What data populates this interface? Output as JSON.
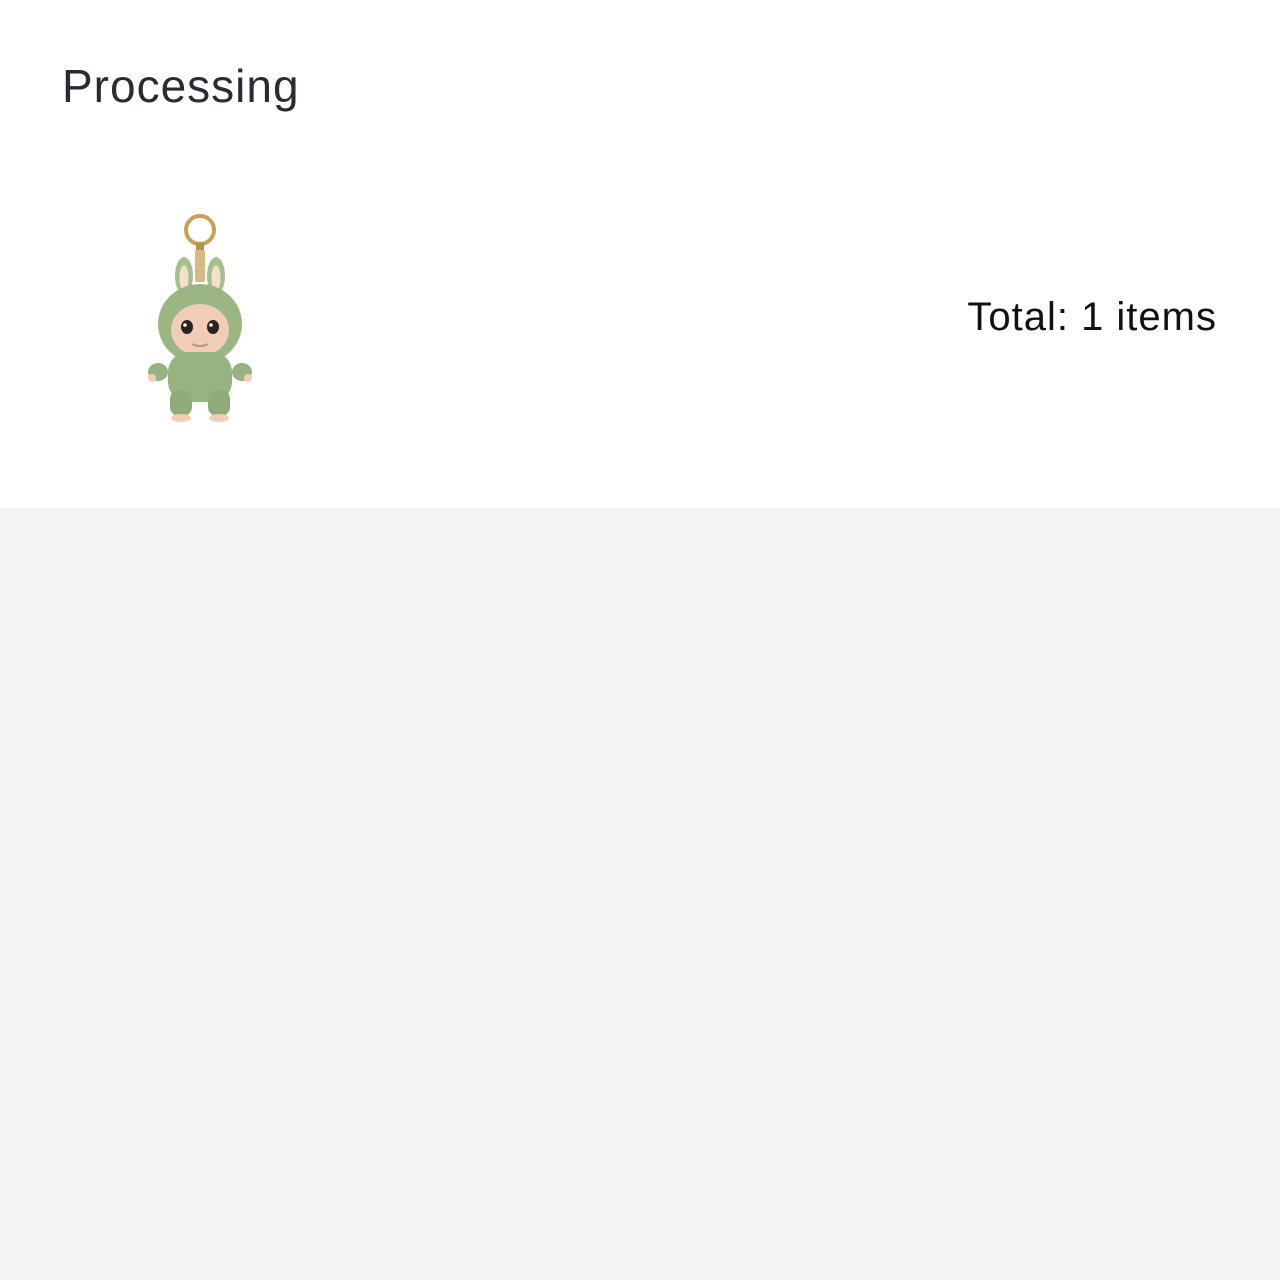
{
  "order": {
    "status_title": "Processing",
    "total_label": "Total: 1 items",
    "item_count": 1,
    "items": [
      {
        "icon": "plush-keychain-doll-icon"
      }
    ]
  },
  "colors": {
    "card_background": "#ffffff",
    "page_background": "#f4f4f4",
    "plush_green": "#9bb585",
    "keyring_gold": "#c9a25a"
  }
}
